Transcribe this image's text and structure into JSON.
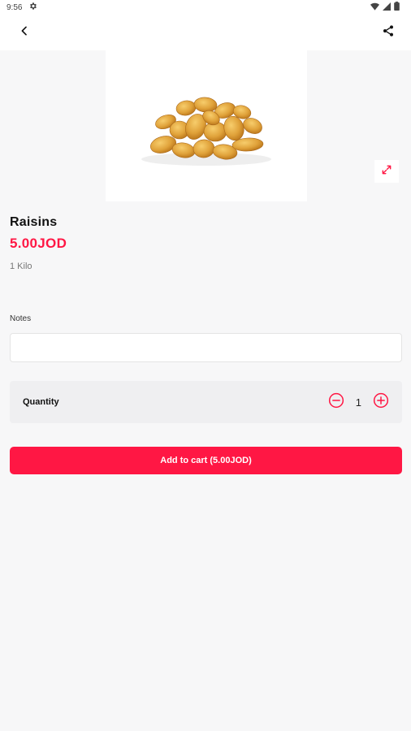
{
  "status_bar": {
    "time": "9:56",
    "settings_icon": "gear-icon",
    "wifi_icon": "wifi-icon",
    "signal_icon": "cell-signal-icon",
    "battery_icon": "battery-icon"
  },
  "app_bar": {
    "back_icon": "chevron-left-icon",
    "share_icon": "share-icon"
  },
  "product": {
    "image": "raisins-photo",
    "expand_icon": "expand-icon",
    "name": "Raisins",
    "price": "5.00JOD",
    "unit": "1 Kilo"
  },
  "notes": {
    "label": "Notes",
    "value": "",
    "placeholder": ""
  },
  "quantity": {
    "label": "Quantity",
    "value": "1",
    "decrement_icon": "minus-circle-icon",
    "increment_icon": "plus-circle-icon"
  },
  "cart_button": {
    "label": "Add to cart (5.00JOD)"
  },
  "colors": {
    "accent": "#ff1744",
    "background": "#f7f7f8",
    "card": "#efeff1",
    "text": "#111111",
    "muted": "#777777"
  }
}
